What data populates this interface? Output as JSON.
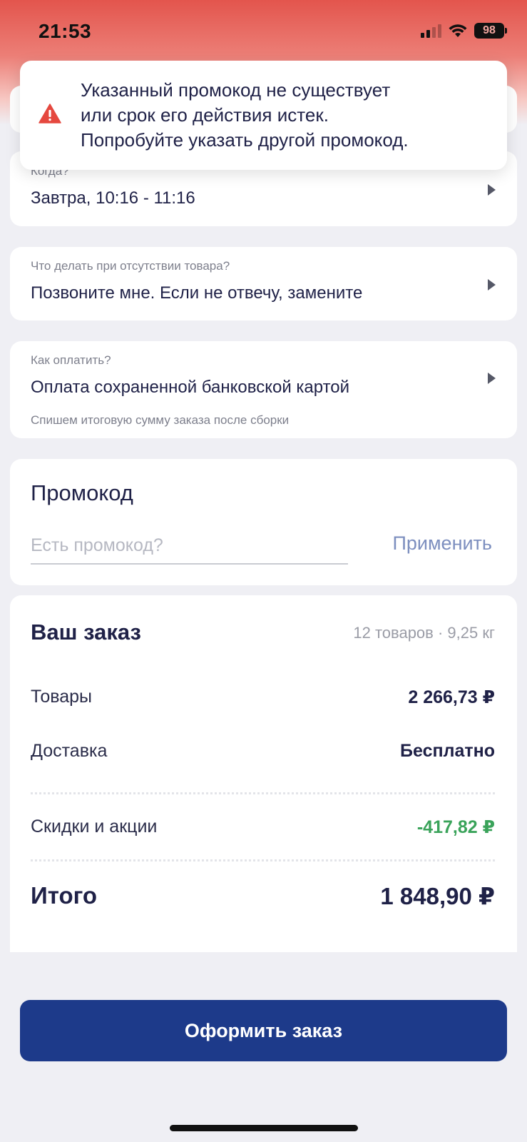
{
  "status_bar": {
    "time": "21:53",
    "battery": "98"
  },
  "toast": {
    "lines": [
      "Указанный промокод не существует",
      "или срок его действия истек.",
      "Попробуйте указать другой промокод."
    ],
    "icon": "warning-icon",
    "icon_color": "#e5483f"
  },
  "when": {
    "label": "Когда?",
    "value": "Завтра, 10:16 - 11:16"
  },
  "missing_item": {
    "label": "Что делать при отсутствии товара?",
    "value": "Позвоните мне. Если не отвечу, замените"
  },
  "payment": {
    "label": "Как оплатить?",
    "value": "Оплата сохраненной банковской картой",
    "hint": "Спишем итоговую сумму заказа после сборки"
  },
  "promo": {
    "title": "Промокод",
    "placeholder": "Есть промокод?",
    "apply_label": "Применить"
  },
  "order": {
    "title": "Ваш заказ",
    "meta": "12 товаров · 9,25 кг",
    "goods_label": "Товары",
    "goods_value": "2 266,73 ₽",
    "delivery_label": "Доставка",
    "delivery_value": "Бесплатно",
    "discount_label": "Скидки и акции",
    "discount_value": "-417,82 ₽",
    "total_label": "Итого",
    "total_value": "1 848,90 ₽"
  },
  "submit_label": "Оформить заказ",
  "colors": {
    "accent": "#1d3a8a",
    "discount": "#3aa35a",
    "link": "#7d8fbf",
    "status_bar": "#e3554d"
  }
}
